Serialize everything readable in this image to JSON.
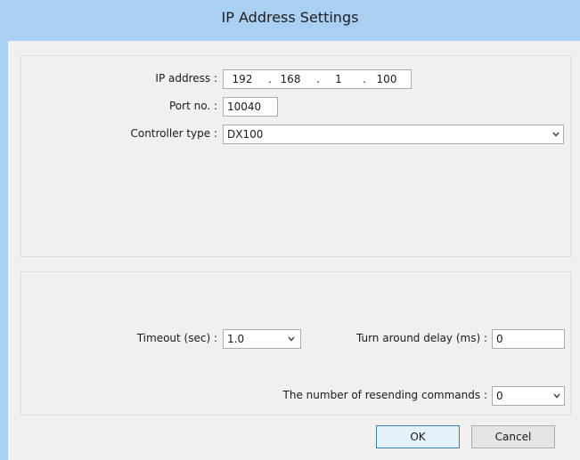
{
  "window": {
    "title": "IP Address Settings"
  },
  "connection": {
    "ip_label": "IP address :",
    "ip_parts": [
      "192",
      "168",
      "1",
      "100"
    ],
    "ip_separator": ".",
    "port_label": "Port no. :",
    "port_value": "10040",
    "controller_label": "Controller type :",
    "controller_value": "DX100"
  },
  "timing": {
    "timeout_label": "Timeout (sec) :",
    "timeout_value": "1.0",
    "turnaround_label": "Turn around delay (ms) :",
    "turnaround_value": "0",
    "resend_label": "The number of resending commands :",
    "resend_value": "0"
  },
  "buttons": {
    "ok": "OK",
    "cancel": "Cancel"
  },
  "icons": {
    "dropdown": "chevron-down-icon"
  },
  "colors": {
    "titlebar": "#a9cff2",
    "client": "#f0f0f0",
    "default_button_border": "#3c7fb1"
  }
}
